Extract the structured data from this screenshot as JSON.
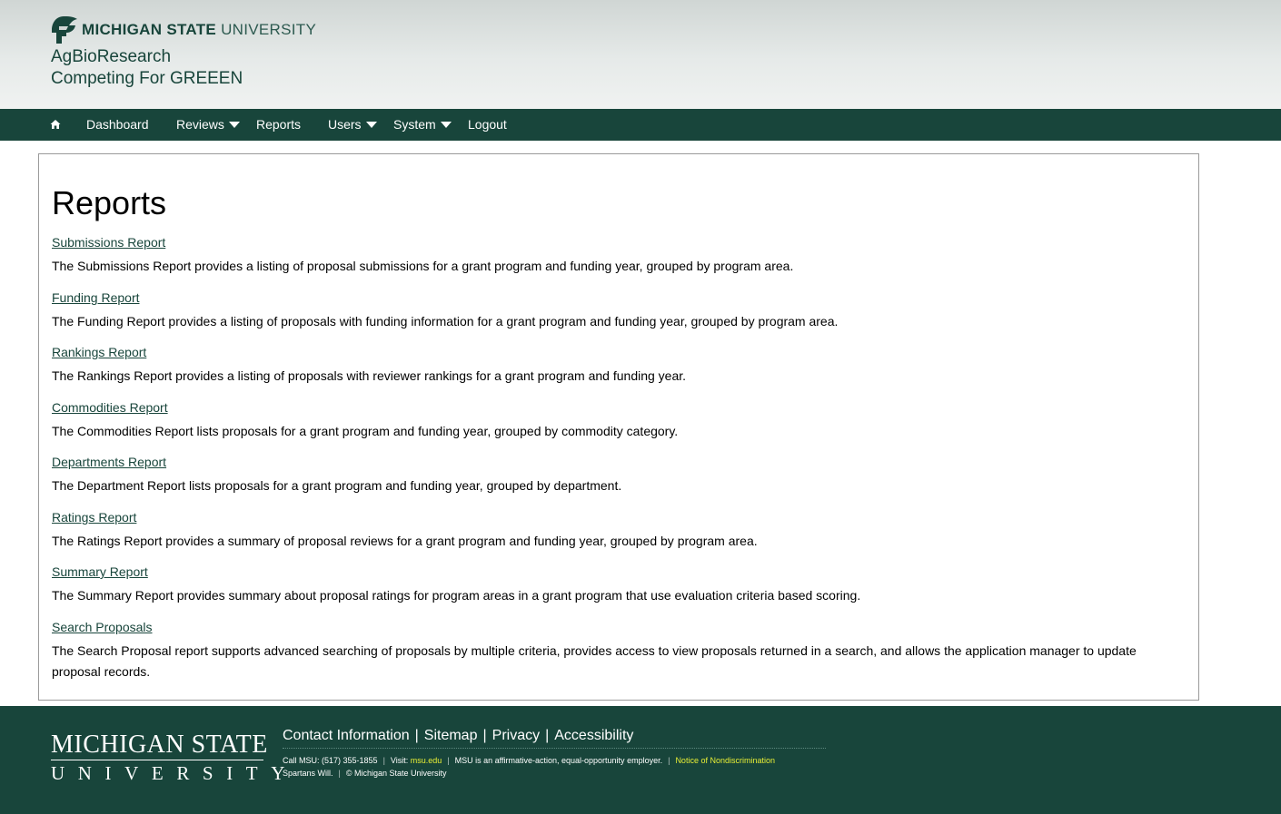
{
  "header": {
    "brand_bold": "MICHIGAN STATE",
    "brand_light": "UNIVERSITY",
    "site_title": "AgBioResearch",
    "site_subtitle": "Competing For GREEEN"
  },
  "nav": {
    "items": [
      {
        "label": "Dashboard",
        "has_dropdown": false
      },
      {
        "label": "Reviews",
        "has_dropdown": true
      },
      {
        "label": "Reports",
        "has_dropdown": false
      },
      {
        "label": "Users",
        "has_dropdown": true
      },
      {
        "label": "System",
        "has_dropdown": true
      },
      {
        "label": "Logout",
        "has_dropdown": false
      }
    ],
    "home_icon": "home-icon"
  },
  "main": {
    "title": "Reports",
    "reports": [
      {
        "link": "Submissions Report",
        "description": "The Submissions Report provides a listing of proposal submissions for a grant program and funding year, grouped by program area."
      },
      {
        "link": "Funding Report",
        "description": "The Funding Report provides a listing of proposals with funding information for a grant program and funding year, grouped by program area."
      },
      {
        "link": "Rankings Report",
        "description": "The Rankings Report provides a listing of proposals with reviewer rankings for a grant program and funding year."
      },
      {
        "link": "Commodities Report",
        "description": "The Commodities Report lists proposals for a grant program and funding year, grouped by commodity category."
      },
      {
        "link": "Departments Report",
        "description": "The Department Report lists proposals for a grant program and funding year, grouped by department."
      },
      {
        "link": "Ratings Report",
        "description": "The Ratings Report provides a summary of proposal reviews for a grant program and funding year, grouped by program area."
      },
      {
        "link": "Summary Report",
        "description": "The Summary Report provides summary about proposal ratings for program areas in a grant program that use evaluation criteria based scoring."
      },
      {
        "link": "Search Proposals",
        "description": "The Search Proposal report supports advanced searching of proposals by multiple criteria, provides access to view proposals returned in a search, and allows the application manager to update proposal records."
      }
    ]
  },
  "footer": {
    "logo_line1": "MICHIGAN STATE",
    "logo_line2": "UNIVERSITY",
    "links": [
      "Contact Information",
      "Sitemap",
      "Privacy",
      "Accessibility"
    ],
    "call": "Call MSU: (517) 355-1855",
    "visit_label": "Visit:",
    "visit_link": "msu.edu",
    "eeo": "MSU is an affirmative-action, equal-opportunity employer.",
    "notice": "Notice of Nondiscrimination",
    "spartans": "Spartans Will.",
    "copyright": "© Michigan State University"
  },
  "colors": {
    "msu_green": "#18453b",
    "footer_highlight": "#e8ee35"
  }
}
